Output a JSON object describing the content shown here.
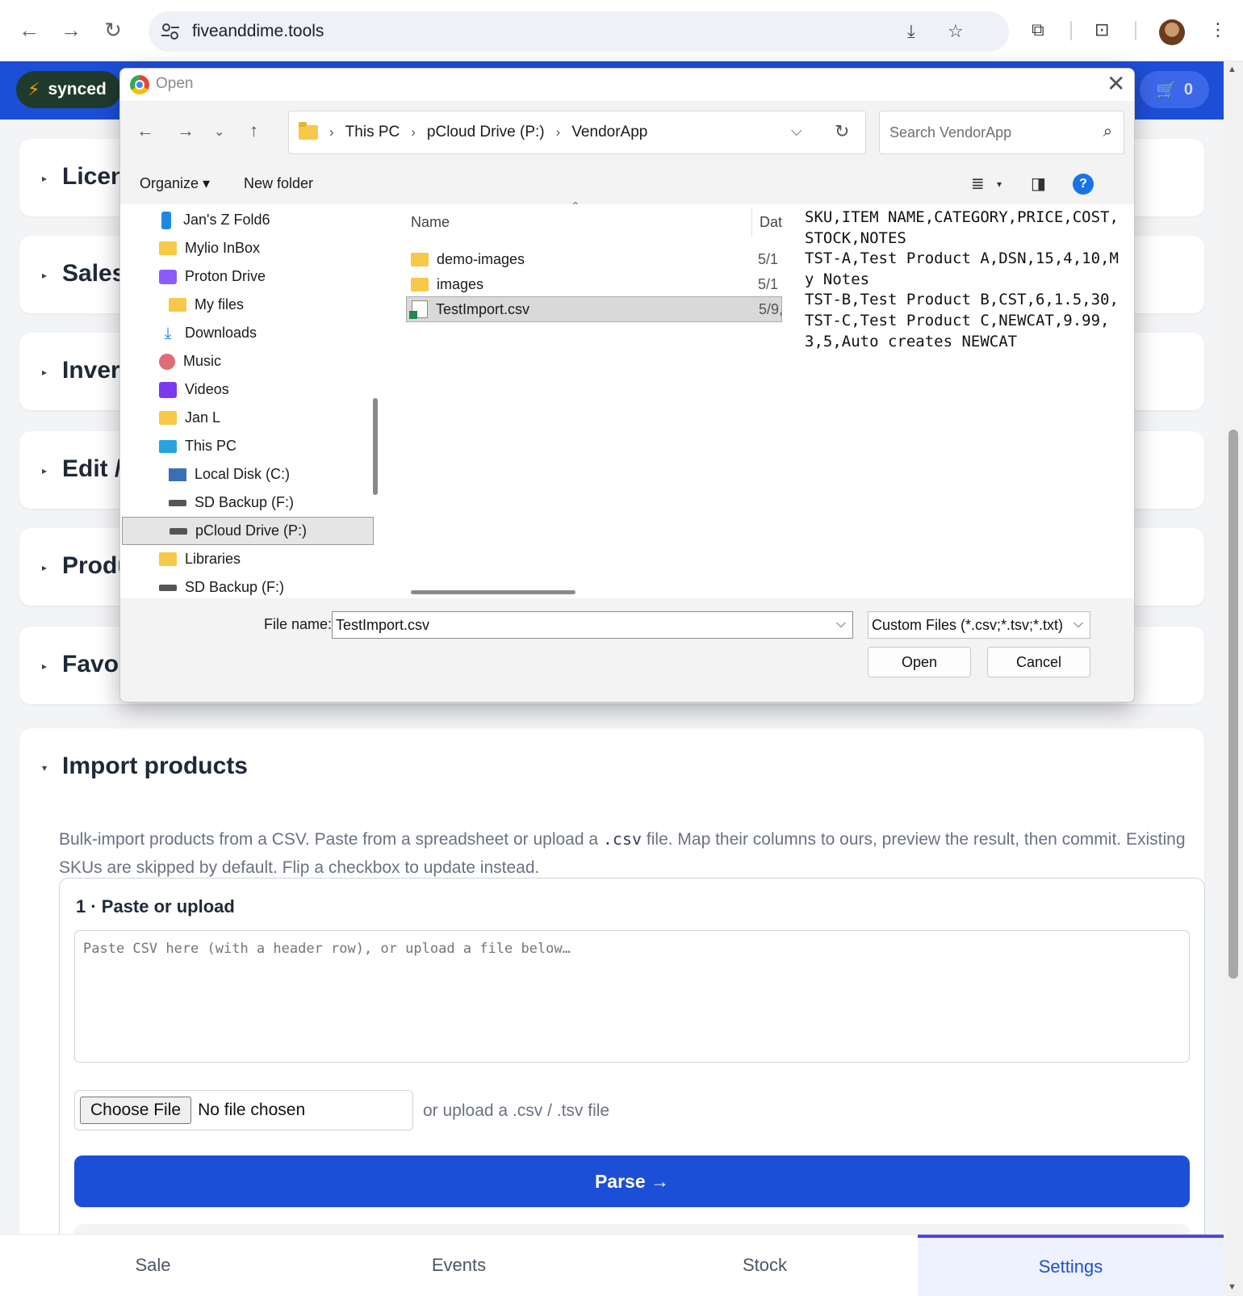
{
  "browser": {
    "url": "fiveanddime.tools"
  },
  "app": {
    "sync_status": "synced",
    "cart_count": "0"
  },
  "sections": [
    {
      "title": "Licen"
    },
    {
      "title": "Sales"
    },
    {
      "title": "Inver"
    },
    {
      "title": "Edit /"
    },
    {
      "title": "Produ"
    },
    {
      "title": "Favor"
    }
  ],
  "import": {
    "title": "Import products",
    "desc_pre": "Bulk-import products from a CSV. Paste from a spreadsheet or upload a ",
    "desc_code": ".csv",
    "desc_post": " file. Map their columns to ours, preview the result, then commit. Existing SKUs are skipped by default. Flip a checkbox to update instead.",
    "step1_title": "1 · Paste or upload",
    "textarea_placeholder": "Paste CSV here (with a header row), or upload a file below…",
    "choose_file": "Choose File",
    "no_file": "No file chosen",
    "upload_hint": "or upload a .csv / .tsv file",
    "parse_button": "Parse →"
  },
  "bottom_nav": [
    {
      "label": "Sale"
    },
    {
      "label": "Events"
    },
    {
      "label": "Stock"
    },
    {
      "label": "Settings"
    }
  ],
  "dialog": {
    "title": "Open",
    "breadcrumb": [
      "This PC",
      "pCloud Drive (P:)",
      "VendorApp"
    ],
    "search_placeholder": "Search VendorApp",
    "organize": "Organize",
    "new_folder": "New folder",
    "nav_items": [
      {
        "label": "Jan's Z Fold6",
        "icon": "phone-icon"
      },
      {
        "label": "Mylio InBox",
        "icon": "folder-icon"
      },
      {
        "label": "Proton Drive",
        "icon": "proton-drive-icon"
      },
      {
        "label": "My files",
        "icon": "folder-icon"
      },
      {
        "label": "Downloads",
        "icon": "download-icon"
      },
      {
        "label": "Music",
        "icon": "music-icon"
      },
      {
        "label": "Videos",
        "icon": "video-icon"
      },
      {
        "label": "Jan L",
        "icon": "folder-icon"
      },
      {
        "label": "This PC",
        "icon": "computer-icon"
      },
      {
        "label": "Local Disk (C:)",
        "icon": "disk-icon"
      },
      {
        "label": "SD Backup (F:)",
        "icon": "drive-icon"
      },
      {
        "label": "pCloud Drive (P:)",
        "icon": "drive-icon"
      },
      {
        "label": "Libraries",
        "icon": "folder-icon"
      },
      {
        "label": "SD Backup (F:)",
        "icon": "drive-icon"
      }
    ],
    "columns": {
      "name": "Name",
      "date": "Dat"
    },
    "files": [
      {
        "name": "demo-images",
        "date": "5/1",
        "type": "folder"
      },
      {
        "name": "images",
        "date": "5/1",
        "type": "folder"
      },
      {
        "name": "TestImport.csv",
        "date": "5/9,",
        "type": "csv"
      }
    ],
    "preview_text": "SKU,ITEM NAME,CATEGORY,PRICE,COST,STOCK,NOTES\nTST-A,Test Product A,DSN,15,4,10,My Notes\nTST-B,Test Product B,CST,6,1.5,30,\nTST-C,Test Product C,NEWCAT,9.99,3,5,Auto creates NEWCAT",
    "file_name_label": "File name:",
    "file_name_value": "TestImport.csv",
    "file_type": "Custom Files (*.csv;*.tsv;*.txt)",
    "open_button": "Open",
    "cancel_button": "Cancel"
  }
}
